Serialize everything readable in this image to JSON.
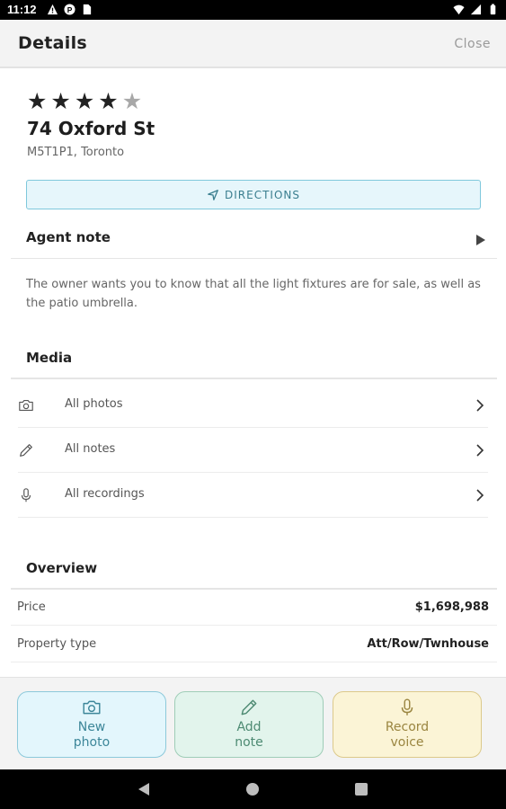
{
  "status_bar": {
    "time": "11:12",
    "left_icons": [
      "alert-icon",
      "parking-icon",
      "sim-icon"
    ],
    "right_icons": [
      "wifi-icon",
      "signal-icon",
      "battery-icon"
    ]
  },
  "header": {
    "title": "Details",
    "close_label": "Close"
  },
  "listing": {
    "rating": 4,
    "rating_max": 5,
    "address": "74 Oxford St",
    "postal": "M5T1P1, Toronto",
    "directions_label": "DIRECTIONS"
  },
  "agent_note": {
    "title": "Agent note",
    "text": "The owner wants you to know that all the light fixtures are for sale, as well as the patio umbrella."
  },
  "media": {
    "title": "Media",
    "items": [
      {
        "icon": "camera-icon",
        "label": "All photos"
      },
      {
        "icon": "pencil-icon",
        "label": "All notes"
      },
      {
        "icon": "microphone-icon",
        "label": "All recordings"
      }
    ]
  },
  "overview": {
    "title": "Overview",
    "rows": [
      {
        "label": "Price",
        "value": "$1,698,988"
      },
      {
        "label": "Property type",
        "value": "Att/Row/Twnhouse"
      }
    ]
  },
  "actions": {
    "photo": {
      "line1": "New",
      "line2": "photo",
      "icon": "camera-icon"
    },
    "note": {
      "line1": "Add",
      "line2": "note",
      "icon": "pencil-icon"
    },
    "voice": {
      "line1": "Record",
      "line2": "voice",
      "icon": "microphone-icon"
    }
  },
  "colors": {
    "directions_bg": "#e6f6fb",
    "photo_bg": "#e3f6fc",
    "note_bg": "#e2f4ec",
    "voice_bg": "#fbf4d6"
  }
}
